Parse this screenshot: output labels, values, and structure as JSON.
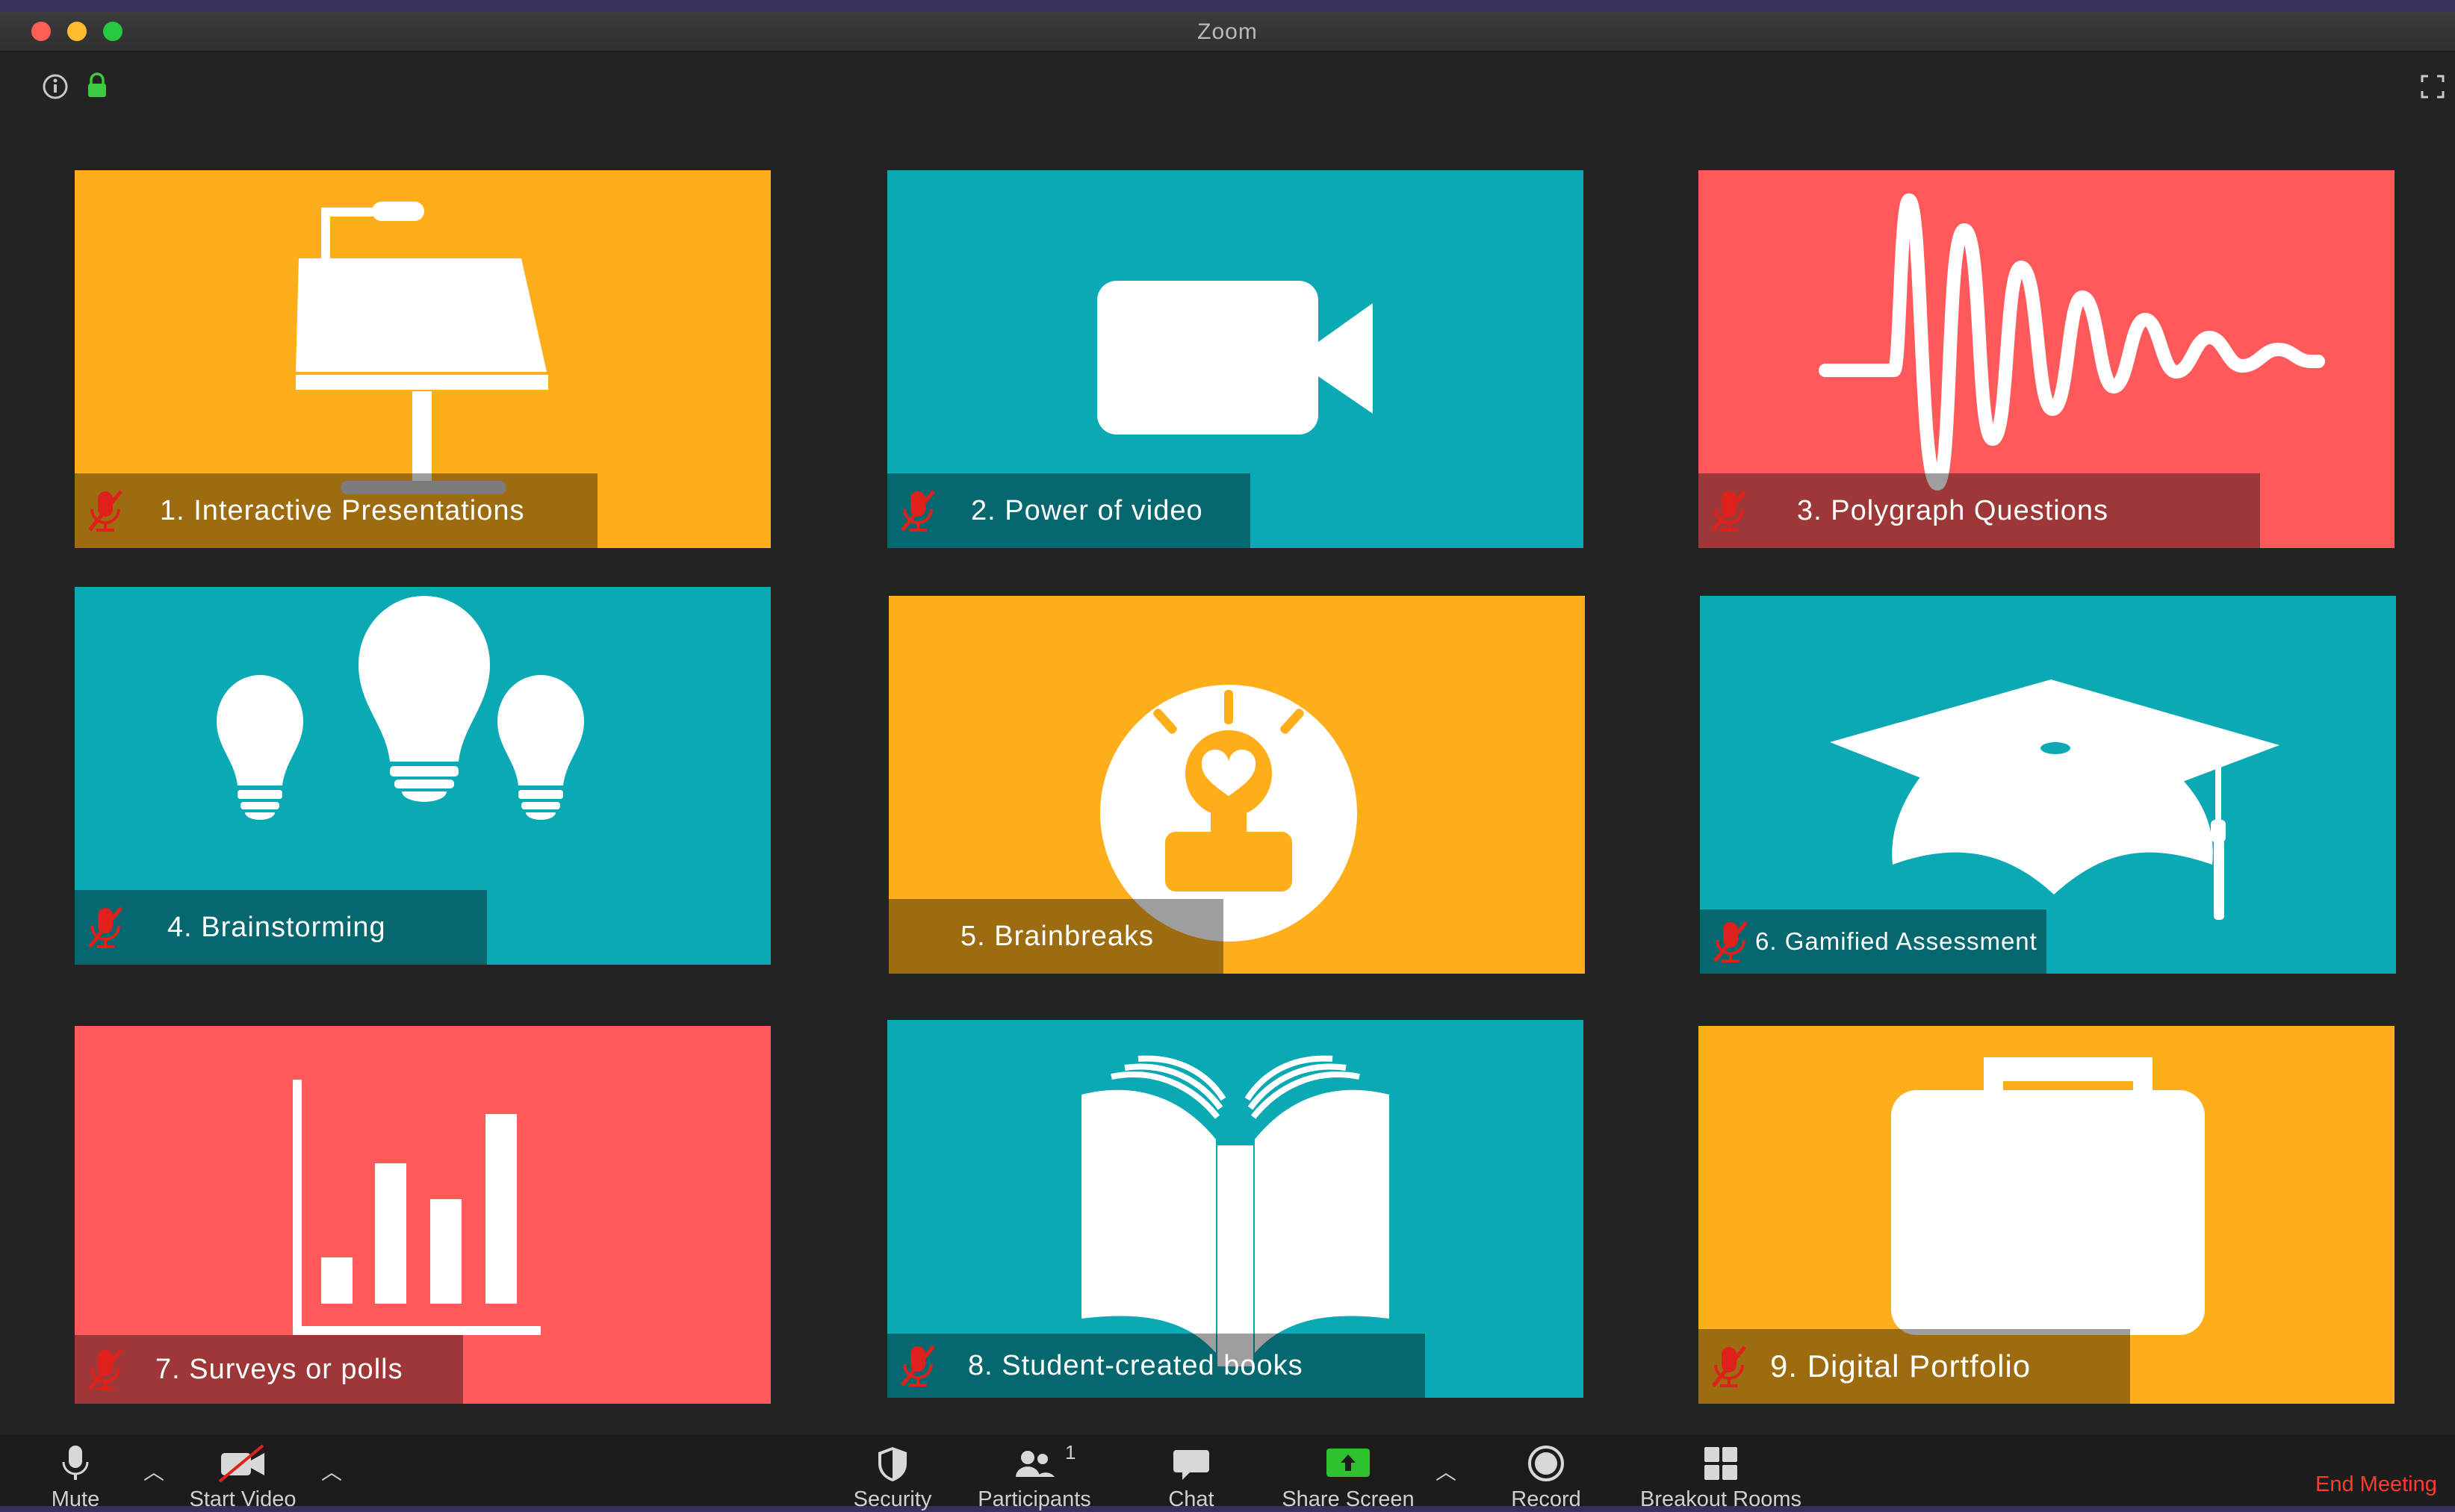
{
  "window": {
    "title": "Zoom"
  },
  "colors": {
    "orange": "#fdae1a",
    "teal": "#0ba9b4",
    "coral": "#fe5a5b",
    "toolbar_bg": "#1c1c1c",
    "end_meeting": "#ff3b30"
  },
  "tiles": [
    {
      "label": "1. Interactive Presentations",
      "icon": "presentation-lamp-icon"
    },
    {
      "label": "2. Power of video",
      "icon": "video-camera-icon"
    },
    {
      "label": "3. Polygraph Questions",
      "icon": "waveform-icon"
    },
    {
      "label": "4. Brainstorming",
      "icon": "light-bulbs-icon"
    },
    {
      "label": "5. Brainbreaks",
      "icon": "heart-bulb-icon"
    },
    {
      "label": "6. Gamified Assessment",
      "icon": "graduation-cap-icon"
    },
    {
      "label": "7. Surveys or polls",
      "icon": "bar-chart-icon"
    },
    {
      "label": "8. Student-created books",
      "icon": "open-book-icon"
    },
    {
      "label": "9. Digital Portfolio",
      "icon": "briefcase-icon"
    }
  ],
  "toolbar": {
    "mute": "Mute",
    "start_video": "Start Video",
    "security": "Security",
    "participants": "Participants",
    "participants_count": "1",
    "chat": "Chat",
    "share_screen": "Share Screen",
    "record": "Record",
    "breakout_rooms": "Breakout Rooms",
    "end_meeting": "End Meeting"
  }
}
